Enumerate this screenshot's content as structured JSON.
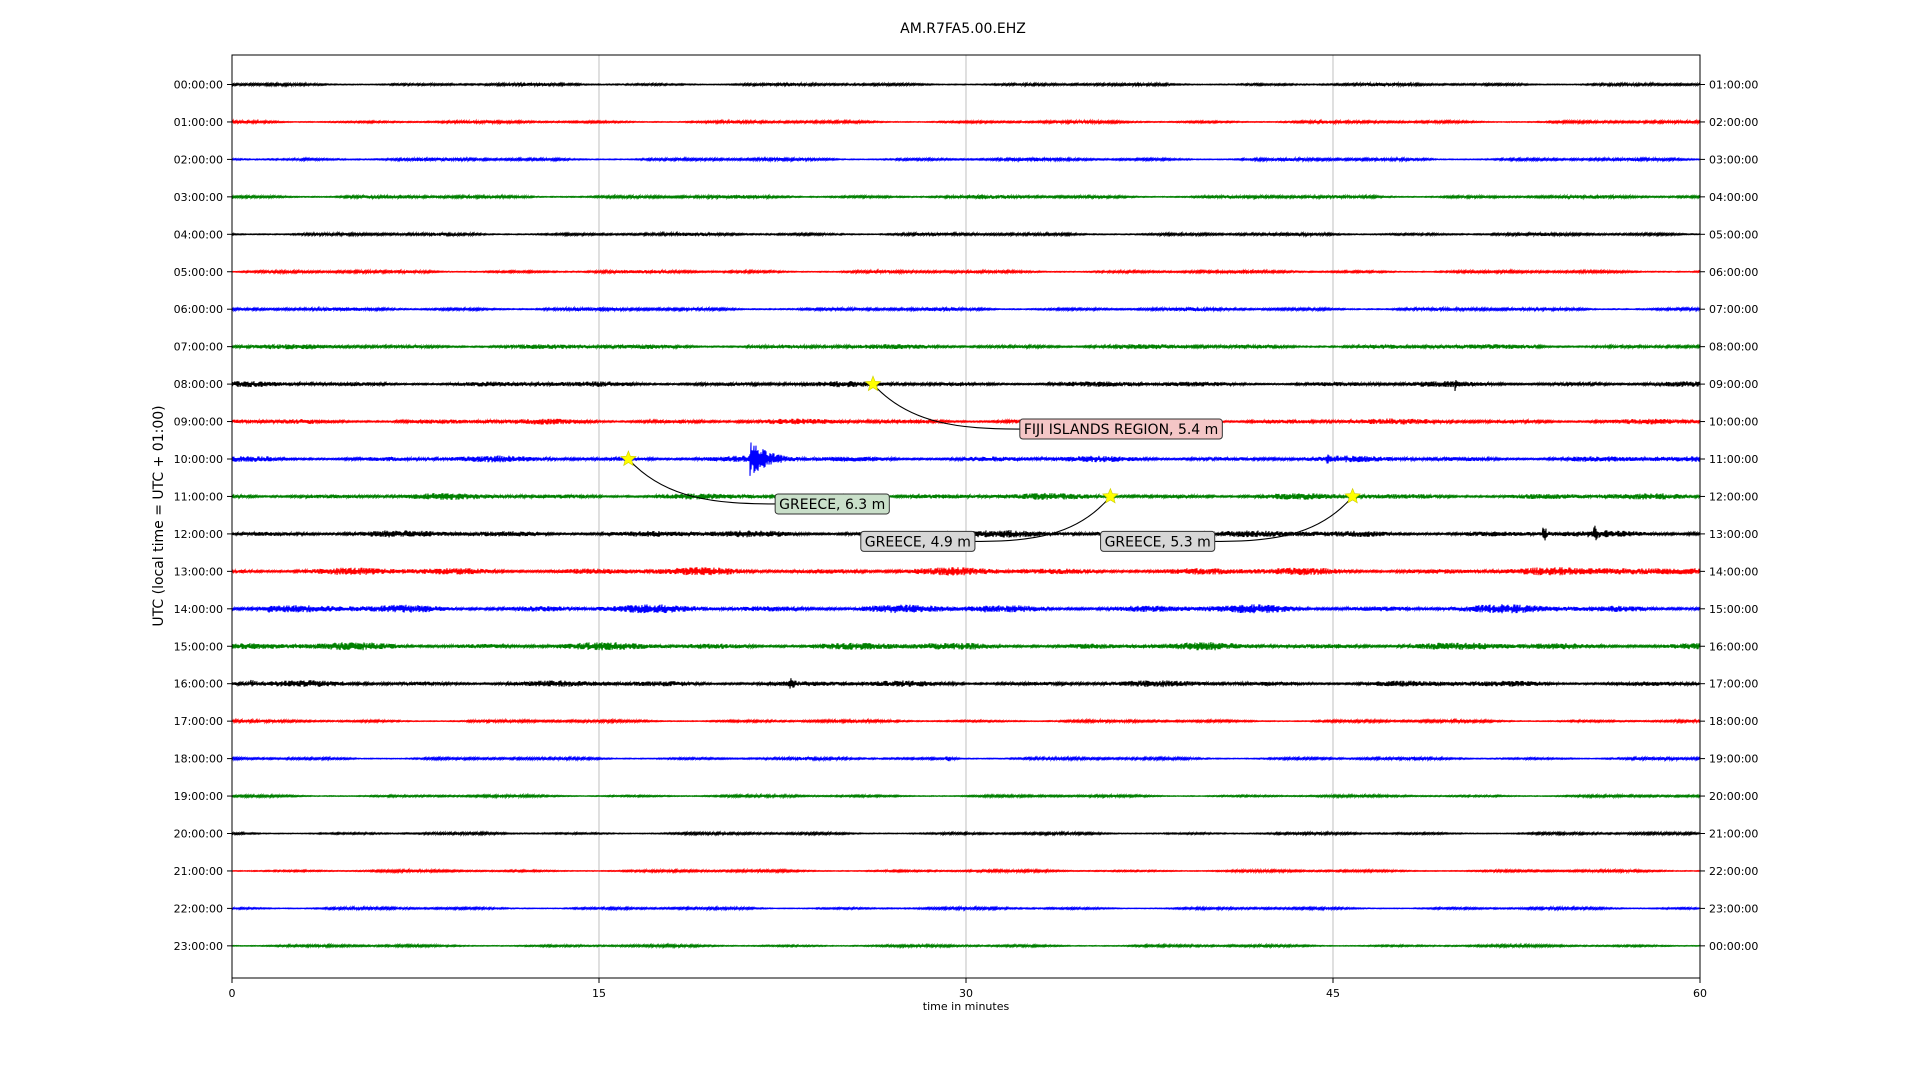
{
  "chart_data": {
    "type": "line",
    "title": "AM.R7FA5.00.EHZ",
    "xlabel": "time in minutes",
    "ylabel": "UTC (local time = UTC + 01:00)",
    "xlim": [
      0,
      60
    ],
    "xticks": [
      0,
      15,
      30,
      45,
      60
    ],
    "grid": "vertical",
    "colors": [
      "#000000",
      "#ff0000",
      "#0000ff",
      "#008000"
    ],
    "rows_left_labels": [
      "00:00:00",
      "01:00:00",
      "02:00:00",
      "03:00:00",
      "04:00:00",
      "05:00:00",
      "06:00:00",
      "07:00:00",
      "08:00:00",
      "09:00:00",
      "10:00:00",
      "11:00:00",
      "12:00:00",
      "13:00:00",
      "14:00:00",
      "15:00:00",
      "16:00:00",
      "17:00:00",
      "18:00:00",
      "19:00:00",
      "20:00:00",
      "21:00:00",
      "22:00:00",
      "23:00:00"
    ],
    "rows_right_labels": [
      "01:00:00",
      "02:00:00",
      "03:00:00",
      "04:00:00",
      "05:00:00",
      "06:00:00",
      "07:00:00",
      "08:00:00",
      "09:00:00",
      "10:00:00",
      "11:00:00",
      "12:00:00",
      "13:00:00",
      "14:00:00",
      "15:00:00",
      "16:00:00",
      "17:00:00",
      "18:00:00",
      "19:00:00",
      "20:00:00",
      "21:00:00",
      "22:00:00",
      "23:00:00",
      "00:00:00"
    ],
    "noise_levels": [
      0.4,
      0.4,
      0.45,
      0.5,
      0.45,
      0.45,
      0.5,
      0.7,
      0.8,
      0.8,
      0.9,
      0.9,
      1.0,
      1.1,
      1.2,
      1.1,
      0.9,
      0.4,
      0.4,
      0.35,
      0.35,
      0.35,
      0.35,
      0.35
    ],
    "bursts": [
      {
        "row": 8,
        "minute": 50.0,
        "amp": 7,
        "dur": 0.2
      },
      {
        "row": 10,
        "minute": 21.2,
        "amp": 14,
        "dur": 2.5
      },
      {
        "row": 10,
        "minute": 44.8,
        "amp": 4,
        "dur": 1.0
      },
      {
        "row": 12,
        "minute": 53.6,
        "amp": 7,
        "dur": 0.6
      },
      {
        "row": 12,
        "minute": 55.7,
        "amp": 7,
        "dur": 0.6
      },
      {
        "row": 13,
        "minute": 55.0,
        "amp": 3,
        "dur": 6.0
      },
      {
        "row": 14,
        "minute": 1.5,
        "amp": 3,
        "dur": 3.0
      },
      {
        "row": 14,
        "minute": 30.8,
        "amp": 4,
        "dur": 0.3
      },
      {
        "row": 16,
        "minute": 22.8,
        "amp": 6,
        "dur": 0.8
      },
      {
        "row": 16,
        "minute": 0.8,
        "amp": 3,
        "dur": 1.5
      },
      {
        "row": 18,
        "minute": 29.2,
        "amp": 3,
        "dur": 0.8
      }
    ],
    "events": [
      {
        "label": "FIJI ISLANDS REGION, 5.4 m",
        "minute": 26.2,
        "row": 8,
        "label_minute": 32.2,
        "label_row": 9.2,
        "box_color": "#f4c6c6"
      },
      {
        "label": "GREECE, 6.3 m",
        "minute": 16.2,
        "row": 10,
        "label_minute": 22.2,
        "label_row": 11.2,
        "box_color": "#c9dfc9"
      },
      {
        "label": "GREECE, 4.9 m",
        "minute": 35.9,
        "row": 11,
        "label_minute": 25.7,
        "label_row": 12.2,
        "box_color": "#d6d6d6"
      },
      {
        "label": "GREECE, 5.3 m",
        "minute": 45.8,
        "row": 11,
        "label_minute": 35.5,
        "label_row": 12.2,
        "box_color": "#d6d6d6"
      }
    ]
  }
}
